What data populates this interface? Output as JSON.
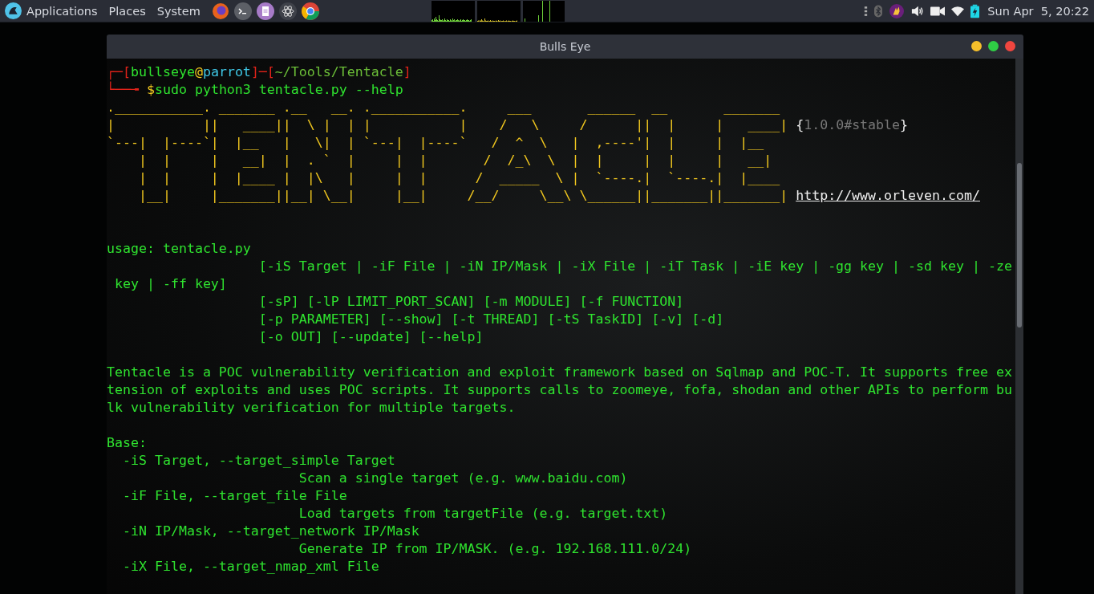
{
  "top_bar": {
    "menus": [
      "Applications",
      "Places",
      "System"
    ],
    "clock": "Sun Apr  5, 20:22"
  },
  "window": {
    "title": "Bulls Eye"
  },
  "terminal": {
    "prompt": {
      "open": "┌─[",
      "user": "bullseye",
      "at": "@",
      "host": "parrot",
      "middle": "]─[",
      "path": "~/Tools/Tentacle",
      "close": "]",
      "arrow": "└──╼ ",
      "dollar": "$",
      "command": "sudo python3 tentacle.py --help"
    },
    "banner": {
      "art": [
        ".___________. _______ .__   __. .___________.     ___       ______  __       _______ ",
        "|           ||   ____||  \\ |  | |           |    /   \\     /      ||  |     |   ____|",
        "`---|  |----`|  |__   |   \\|  | `---|  |----`   /  ^  \\   |  ,----'|  |     |  |__   ",
        "    |  |     |   __|  |  . `  |     |  |       /  /_\\  \\  |  |     |  |     |   __|  ",
        "    |  |     |  |____ |  |\\   |     |  |      /  _____  \\ |  `----.|  `----.|  |____ ",
        "    |__|     |_______||__| \\__|     |__|     /__/     \\__\\ \\______||_______||_______|"
      ],
      "version": {
        "open": "{",
        "text": "1.0.0#stable",
        "close": "}"
      },
      "url": "http://www.orleven.com/"
    },
    "sections": [
      {
        "lines": [
          "usage: tentacle.py",
          "                   [-iS Target | -iF File | -iN IP/Mask | -iX File | -iT Task | -iE key | -gg key | -sd key | -ze",
          " key | -ff key]",
          "                   [-sP] [-lP LIMIT_PORT_SCAN] [-m MODULE] [-f FUNCTION]",
          "                   [-p PARAMETER] [--show] [-t THREAD] [-tS TaskID] [-v] [-d]",
          "                   [-o OUT] [--update] [--help]"
        ]
      },
      {
        "lines": [
          "Tentacle is a POC vulnerability verification and exploit framework based on Sqlmap and POC-T. It supports free ex",
          "tension of exploits and uses POC scripts. It supports calls to zoomeye, fofa, shodan and other APIs to perform bu",
          "lk vulnerability verification for multiple targets."
        ]
      },
      {
        "lines": [
          "Base:",
          "  -iS Target, --target_simple Target",
          "                        Scan a single target (e.g. www.baidu.com)",
          "  -iF File, --target_file File",
          "                        Load targets from targetFile (e.g. target.txt)",
          "  -iN IP/Mask, --target_network IP/Mask",
          "                        Generate IP from IP/MASK. (e.g. 192.168.111.0/24)",
          "  -iX File, --target_nmap_xml File"
        ]
      }
    ]
  }
}
